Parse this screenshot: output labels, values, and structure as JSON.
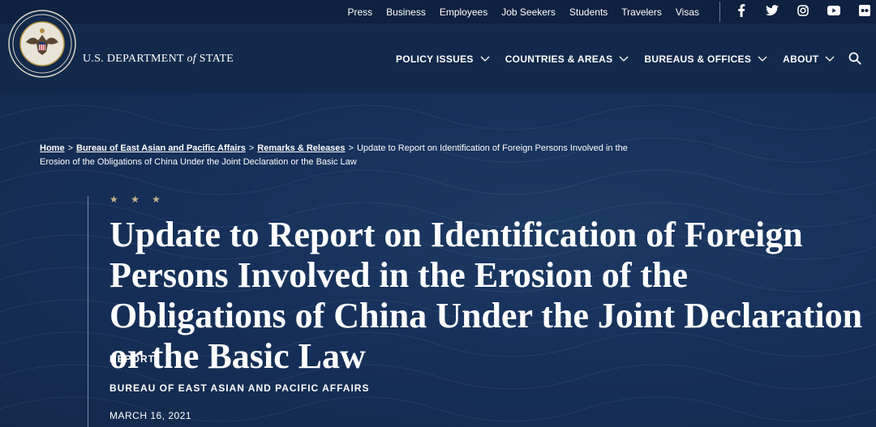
{
  "utility": {
    "links": [
      "Press",
      "Business",
      "Employees",
      "Job Seekers",
      "Students",
      "Travelers",
      "Visas"
    ],
    "social_icons": [
      "facebook-icon",
      "twitter-icon",
      "instagram-icon",
      "youtube-icon",
      "flickr-icon"
    ]
  },
  "brand": {
    "name_prefix": "U.S. DEPARTMENT",
    "name_of": "of",
    "name_suffix": "STATE"
  },
  "nav": {
    "items": [
      "POLICY ISSUES",
      "COUNTRIES & AREAS",
      "BUREAUS & OFFICES",
      "ABOUT"
    ]
  },
  "breadcrumb": {
    "home": "Home",
    "bureau": "Bureau of East Asian and Pacific Affairs",
    "remarks": "Remarks & Releases",
    "current": "Update to Report on Identification of Foreign Persons Involved in the Erosion of the Obligations of China Under the Joint Declaration or the Basic Law",
    "separator": ">"
  },
  "article": {
    "stars": "★ ★ ★",
    "title": "Update to Report on Identification of Foreign Persons Involved in the Erosion of the Obligations of China Under the Joint Declaration or the Basic Law",
    "type": "REPORT",
    "bureau": "BUREAU OF EAST ASIAN AND PACIFIC AFFAIRS",
    "date": "MARCH 16, 2021"
  },
  "colors": {
    "background": "#13294b",
    "top_bar": "#0f2140",
    "star_gold": "#c9b38a"
  }
}
